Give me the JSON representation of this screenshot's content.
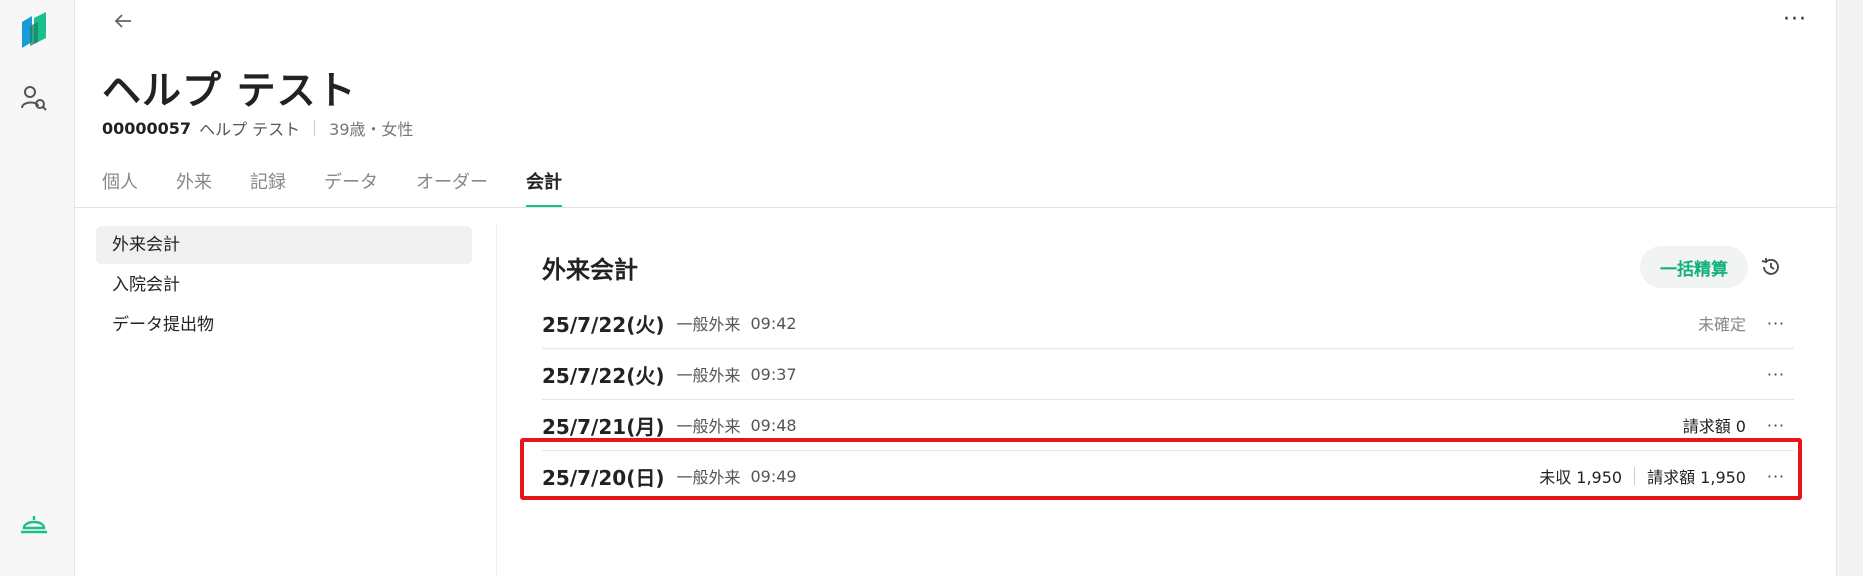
{
  "patient": {
    "name": "ヘルプ テスト",
    "id": "00000057",
    "name_small": "ヘルプ テスト",
    "age_gender": "39歳・女性"
  },
  "tabs": [
    {
      "label": "個人"
    },
    {
      "label": "外来"
    },
    {
      "label": "記録"
    },
    {
      "label": "データ"
    },
    {
      "label": "オーダー"
    },
    {
      "label": "会計",
      "active": true
    }
  ],
  "subnav": [
    {
      "label": "外来会計",
      "active": true
    },
    {
      "label": "入院会計"
    },
    {
      "label": "データ提出物"
    }
  ],
  "section": {
    "title": "外来会計",
    "bulk_button": "一括精算"
  },
  "rows": [
    {
      "date": "25/7/22(火)",
      "kind": "一般外来",
      "time": "09:42",
      "status": "未確定",
      "amounts": []
    },
    {
      "date": "25/7/22(火)",
      "kind": "一般外来",
      "time": "09:37",
      "status": "",
      "amounts": []
    },
    {
      "date": "25/7/21(月)",
      "kind": "一般外来",
      "time": "09:48",
      "status": "",
      "amounts": [
        "請求額 0"
      ]
    },
    {
      "date": "25/7/20(日)",
      "kind": "一般外来",
      "time": "09:49",
      "status": "",
      "amounts": [
        "未収 1,950",
        "請求額 1,950"
      ],
      "highlighted": true
    }
  ],
  "icons": {
    "logo": "app-logo-icon",
    "user_search": "user-search-icon",
    "bell": "service-bell-icon",
    "back": "arrow-left-icon",
    "more": "more-horizontal-icon",
    "history": "history-icon"
  },
  "colors": {
    "accent": "#19c089",
    "bulk_text": "#12b07a",
    "highlight": "#e8141b"
  }
}
